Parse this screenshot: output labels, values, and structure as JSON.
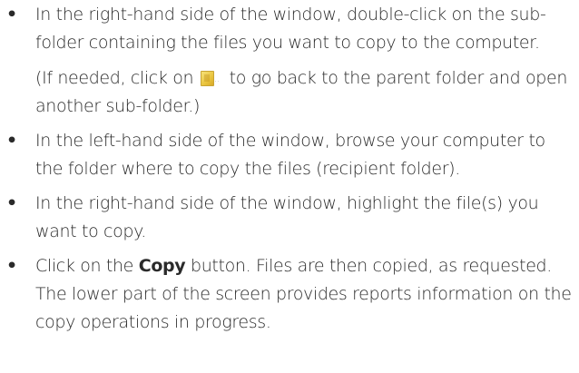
{
  "steps": [
    {
      "text": "In the right-hand side of the window, double-click on the sub-folder containing the files you want to copy to the computer.",
      "note": {
        "before": "(If needed, click on",
        "icon": "folder-up-icon",
        "icon_dots": "..",
        "after": "to go back to the parent folder and open another sub-folder.)"
      }
    },
    {
      "text": "In the left-hand side of the window, browse your computer to the folder where to copy the files (recipient folder)."
    },
    {
      "text": "In the right-hand side of the window, highlight the file(s) you want to copy."
    },
    {
      "before": "Click on the",
      "bold": "Copy",
      "after": "button. Files are then copied, as requested. The lower part of the screen provides reports information on the copy operations in progress."
    }
  ],
  "bullet": "•"
}
